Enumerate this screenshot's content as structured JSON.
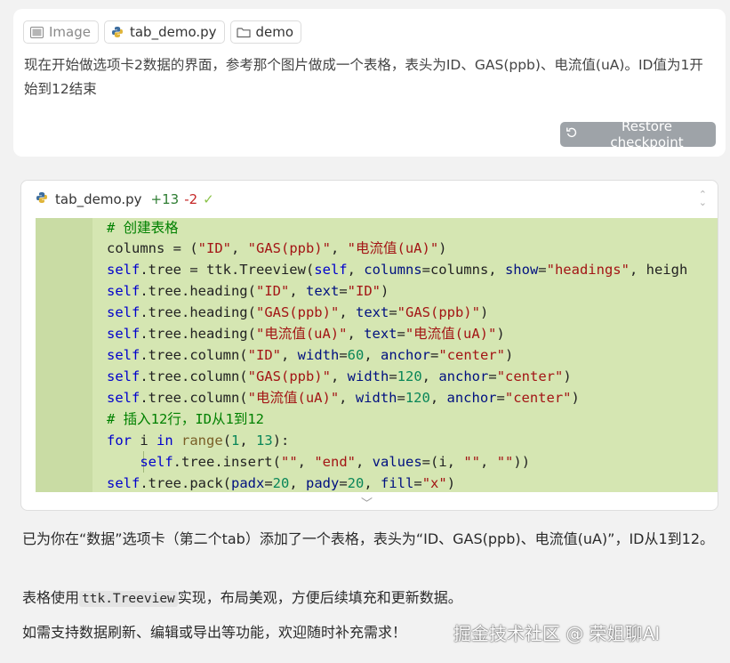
{
  "prompt": {
    "chips": [
      {
        "label": "Image",
        "icon": "image-icon"
      },
      {
        "label": "tab_demo.py",
        "icon": "python-icon"
      },
      {
        "label": "demo",
        "icon": "folder-icon"
      }
    ],
    "text": "现在开始做选项卡2数据的界面，参考那个图片做成一个表格，表头为ID、GAS(ppb)、电流值(uA)。ID值为1开始到12结束",
    "restore_label": "Restore checkpoint"
  },
  "diff": {
    "filename": "tab_demo.py",
    "added": "+13",
    "removed": "-2",
    "code_lines": [
      "# 创建表格",
      "columns = (\"ID\", \"GAS(ppb)\", \"电流值(uA)\")",
      "self.tree = ttk.Treeview(self, columns=columns, show=\"headings\", heigh",
      "self.tree.heading(\"ID\", text=\"ID\")",
      "self.tree.heading(\"GAS(ppb)\", text=\"GAS(ppb)\")",
      "self.tree.heading(\"电流值(uA)\", text=\"电流值(uA)\")",
      "self.tree.column(\"ID\", width=60, anchor=\"center\")",
      "self.tree.column(\"GAS(ppb)\", width=120, anchor=\"center\")",
      "self.tree.column(\"电流值(uA)\", width=120, anchor=\"center\")",
      "# 插入12行，ID从1到12",
      "for i in range(1, 13):",
      "    self.tree.insert(\"\", \"end\", values=(i, \"\", \"\"))",
      "self.tree.pack(padx=20, pady=20, fill=\"x\")"
    ]
  },
  "response": {
    "p1": "已为你在“数据”选项卡（第二个tab）添加了一个表格，表头为“ID、GAS(ppb)、电流值(uA)”，ID从1到12。",
    "p2_before": "表格使用",
    "p2_code": "ttk.Treeview",
    "p2_after": "实现，布局美观，方便后续填充和更新数据。",
    "p3": "如需支持数据刷新、编辑或导出等功能，欢迎随时补充需求！"
  },
  "watermark": "掘金技术社区 @ 荣姐聊AI"
}
